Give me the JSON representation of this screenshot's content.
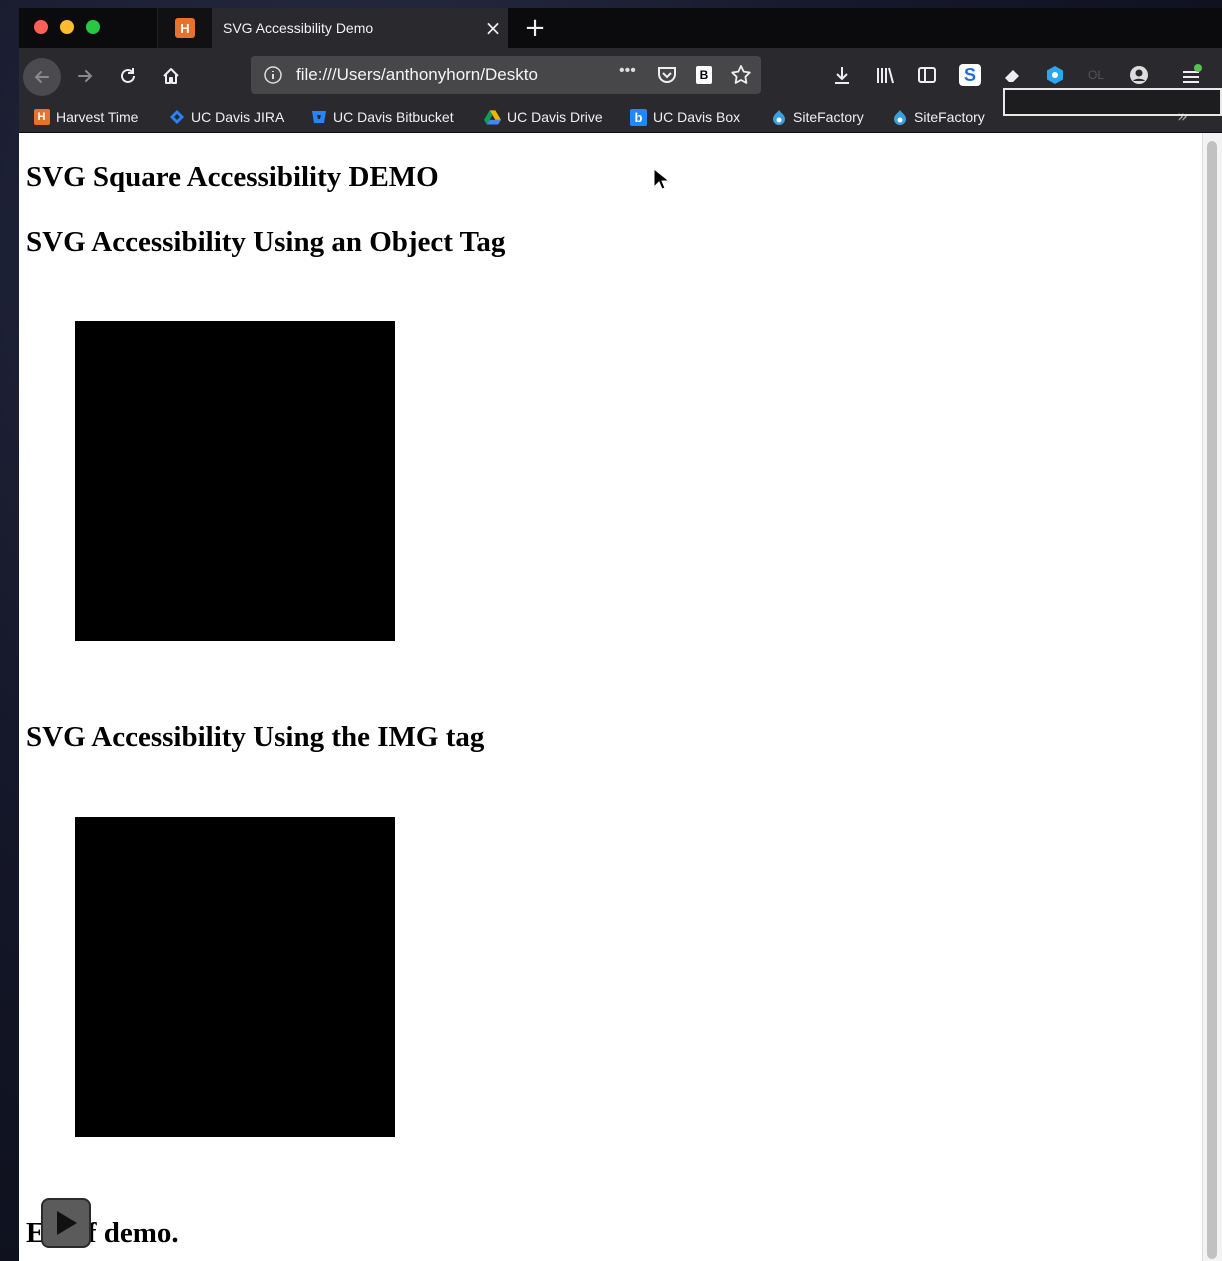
{
  "browser": {
    "tab_inactive_icon": "harvest-favicon-icon",
    "tab_active_title": "SVG Accessibility Demo",
    "tab_close": "×",
    "new_tab": "+",
    "url": "file:///Users/anthonyhorn/Deskto",
    "url_more": "•••"
  },
  "bookmarks": [
    {
      "label": "Harvest Time",
      "icon": "harvest-icon",
      "color": "#e8712b"
    },
    {
      "label": "UC Davis JIRA",
      "icon": "jira-icon",
      "color": "#2684ff"
    },
    {
      "label": "UC Davis Bitbucket",
      "icon": "bitbucket-icon",
      "color": "#2684ff"
    },
    {
      "label": "UC Davis Drive",
      "icon": "drive-icon",
      "color": "#f4b400"
    },
    {
      "label": "UC Davis  Box",
      "icon": "box-icon",
      "color": "#2486fc"
    },
    {
      "label": "SiteFactory",
      "icon": "drupal-icon",
      "color": "#3aa0e0"
    },
    {
      "label": "SiteFactory",
      "icon": "drupal-icon",
      "color": "#3aa0e0"
    }
  ],
  "page": {
    "heading_main": "SVG Square Accessibility DEMO",
    "heading_object": "SVG Accessibility Using an Object Tag",
    "heading_img": "SVG Accessibility Using the IMG tag",
    "heading_end_prefix": "E",
    "heading_end_suffix": "of demo."
  },
  "colors": {
    "tab_bar": "#0b0b0d",
    "toolbar": "#2a2a2e",
    "square": "#000000"
  }
}
